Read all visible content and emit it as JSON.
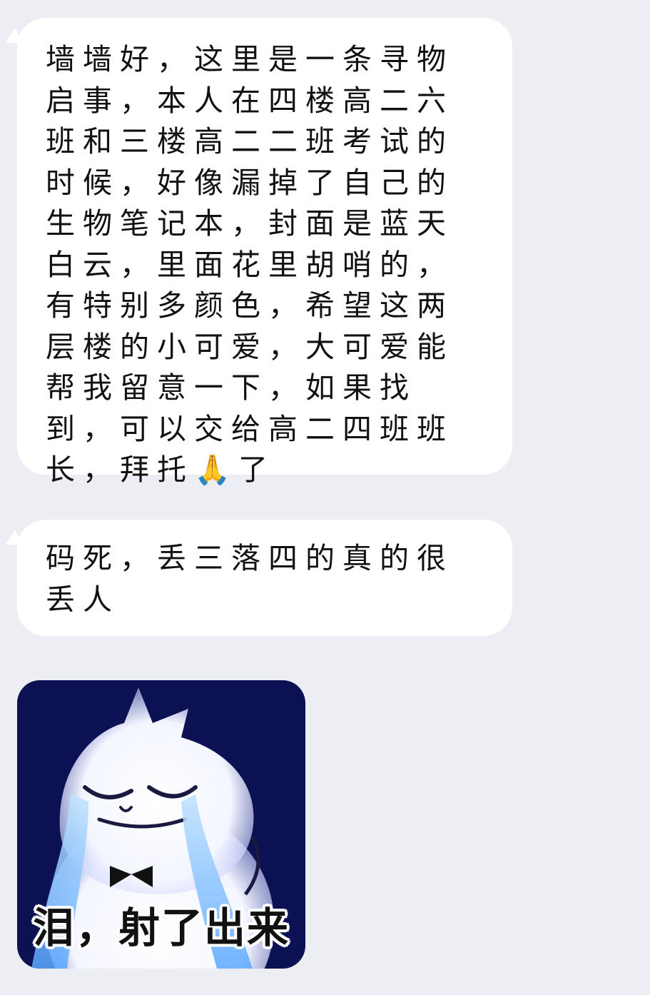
{
  "messages": [
    {
      "text": "墙墙好，这里是一条寻物启事，本人在四楼高二六班和三楼高二二班考试的时候，好像漏掉了自己的生物笔记本，封面是蓝天白云，里面花里胡哨的，有特别多颜色，希望这两层楼的小可爱，大可爱能帮我留意一下，如果找到，可以交给高二四班班长，拜托🙏了"
    },
    {
      "text": "码死，丢三落四的真的很丢人"
    }
  ],
  "sticker": {
    "caption": "泪，射了出来",
    "background_color": "#0b1153",
    "figure": "crying-white-cat"
  },
  "colors": {
    "page_background": "#edeef3",
    "bubble": "#ffffff",
    "tears": "#8fc7ff"
  }
}
